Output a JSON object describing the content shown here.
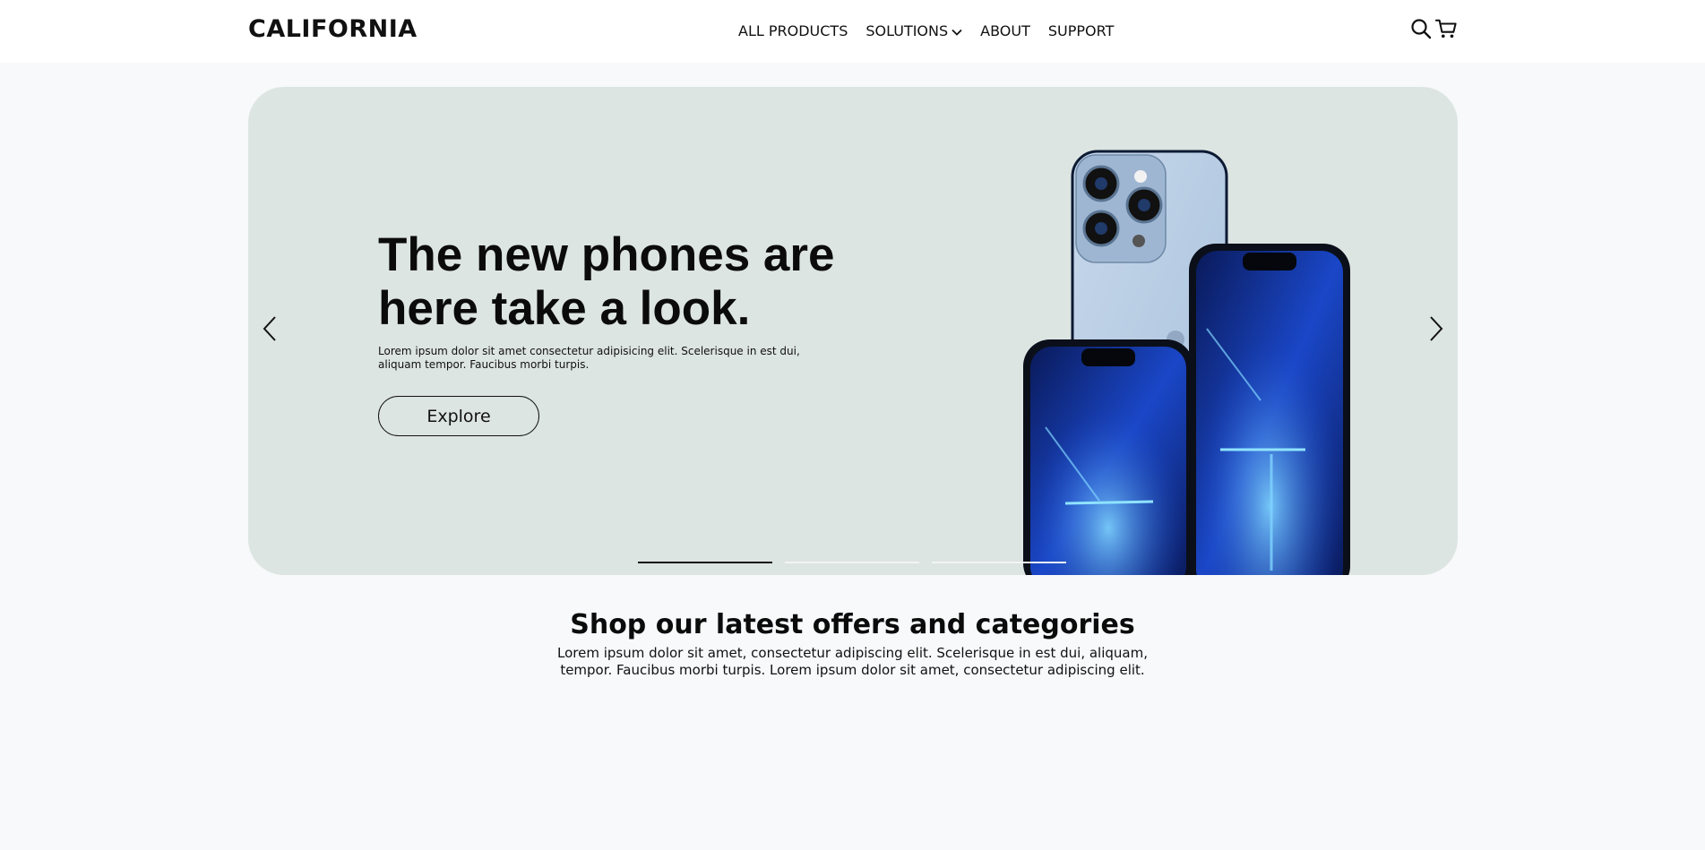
{
  "header": {
    "logo": "CALIFORNIA",
    "nav": [
      {
        "label": "ALL PRODUCTS"
      },
      {
        "label": "SOLUTIONS"
      },
      {
        "label": "ABOUT"
      },
      {
        "label": "SUPPORT"
      }
    ],
    "icons": [
      "search-icon",
      "cart-icon"
    ]
  },
  "hero": {
    "title": "The new phones are here take a look.",
    "description": "Lorem ipsum dolor sit amet consectetur adipisicing elit. Scelerisque in est dui, aliquam tempor. Faucibus morbi turpis.",
    "button_label": "Explore",
    "background": "#dde5e2",
    "slides": 3,
    "active_slide": 1
  },
  "section": {
    "title": "Shop our latest offers and categories",
    "description": "Lorem ipsum dolor sit amet, consectetur adipiscing elit. Scelerisque in est dui, aliquam, tempor. Faucibus morbi turpis. Lorem ipsum dolor sit amet, consectetur adipiscing elit."
  }
}
